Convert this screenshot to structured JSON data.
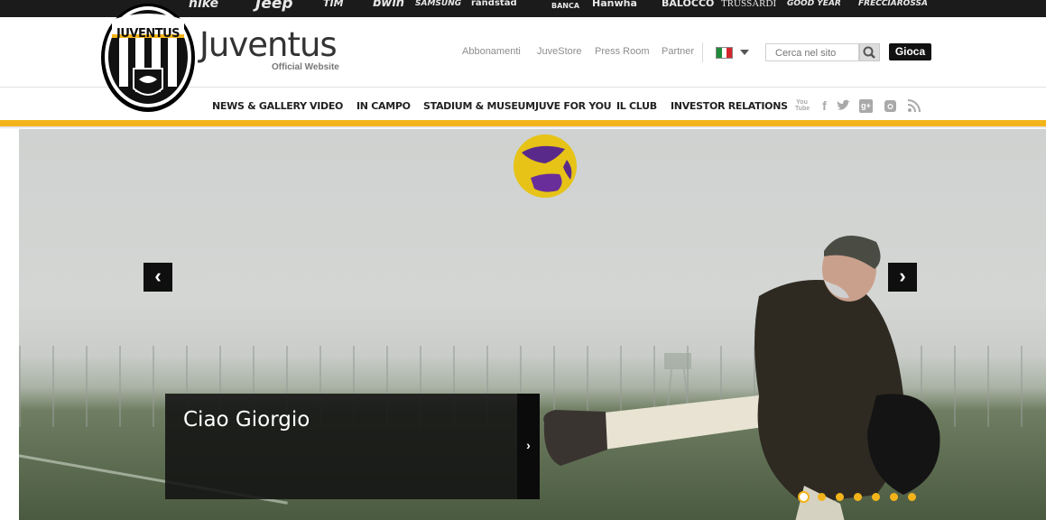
{
  "sponsors": [
    "nike",
    "Jeep",
    "TIM",
    "bwin",
    "SAMSUNG",
    "randstad",
    "BANCA",
    "Hanwha",
    "BALOCCO",
    "TRUSSARDI",
    "GOOD YEAR",
    "FRECCIAROSSA"
  ],
  "brand": {
    "crest_text": "JUVENTUS",
    "title": "Juventus",
    "subtitle": "Official Website"
  },
  "top_links": [
    "Abbonamenti",
    "JuveStore",
    "Press Room",
    "Partner"
  ],
  "language": {
    "flag_colors": [
      "#1f8a3a",
      "#ffffff",
      "#d4262d"
    ]
  },
  "search": {
    "placeholder": "Cerca nel sito"
  },
  "gioca_label": "Gioca",
  "nav": [
    "NEWS & GALLERY",
    "VIDEO",
    "IN CAMPO",
    "STADIUM & MUSEUM",
    "JUVE FOR YOU",
    "IL CLUB",
    "INVESTOR RELATIONS"
  ],
  "social_icons": [
    "youtube-icon",
    "facebook-icon",
    "twitter-icon",
    "google-plus-icon",
    "instagram-icon",
    "rss-icon"
  ],
  "hero": {
    "caption": "Ciao Giorgio",
    "prev_symbol": "‹",
    "next_symbol": "›",
    "more_symbol": "›",
    "slide_count": 7,
    "active_slide": 1
  },
  "colors": {
    "accent": "#f3b41a",
    "dark": "#1b1b1b"
  }
}
